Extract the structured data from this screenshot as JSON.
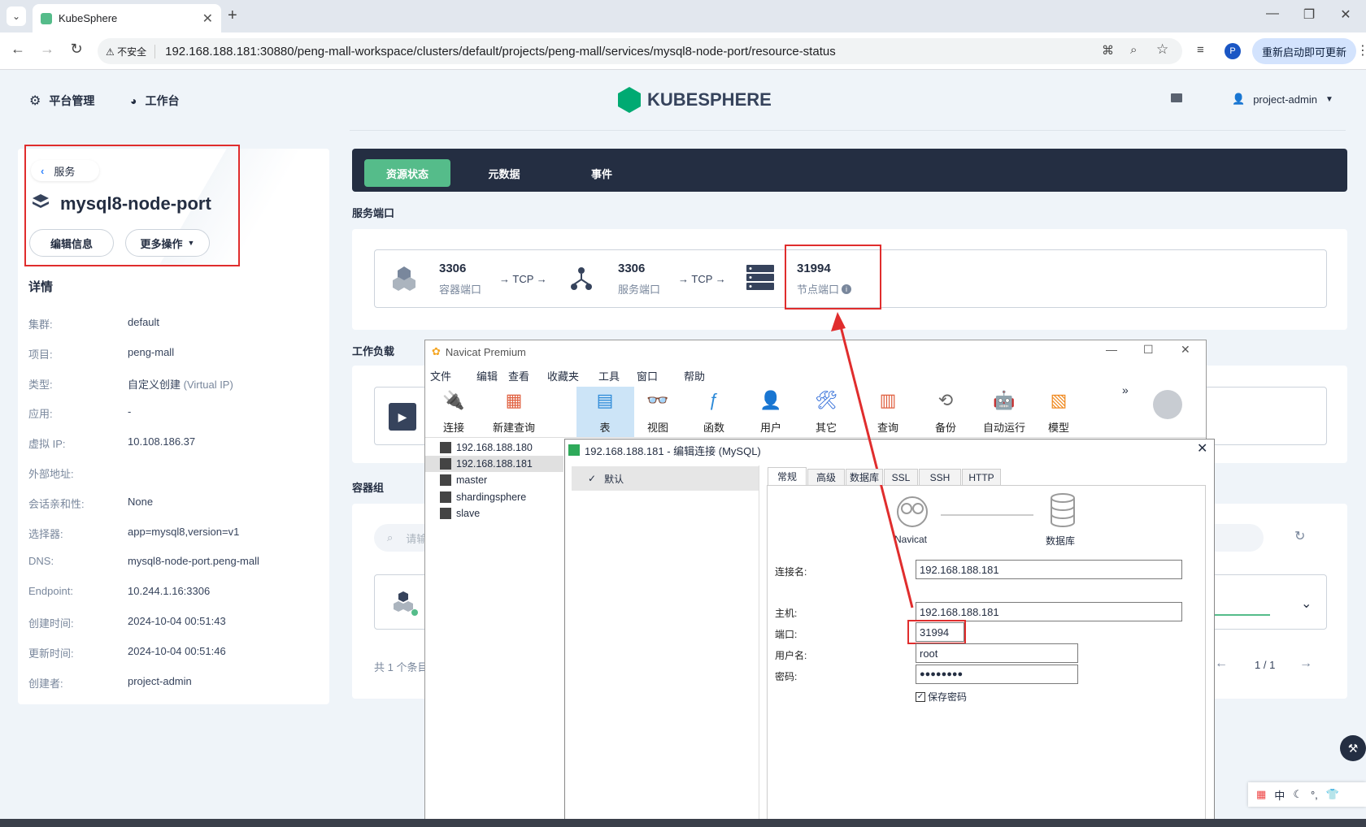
{
  "browser": {
    "tab_title": "KubeSphere",
    "security": "不安全",
    "url": "192.168.188.181:30880/peng-mall-workspace/clusters/default/projects/peng-mall/services/mysql8-node-port/resource-status",
    "update_label": "重新启动即可更新",
    "profile_initial": "P"
  },
  "header": {
    "platform": "平台管理",
    "workbench": "工作台",
    "logo": "KUBESPHERE",
    "user": "project-admin"
  },
  "service": {
    "back_label": "服务",
    "name": "mysql8-node-port",
    "edit_label": "编辑信息",
    "more_label": "更多操作",
    "details_title": "详情",
    "details": [
      {
        "label": "集群:",
        "value": "default"
      },
      {
        "label": "项目:",
        "value": "peng-mall"
      },
      {
        "label": "类型:",
        "value": "自定义创建",
        "extra": "(Virtual IP)"
      },
      {
        "label": "应用:",
        "value": "-"
      },
      {
        "label": "虚拟 IP:",
        "value": "10.108.186.37"
      },
      {
        "label": "外部地址:",
        "value": ""
      },
      {
        "label": "会话亲和性:",
        "value": "None"
      },
      {
        "label": "选择器:",
        "value": "app=mysql8,version=v1"
      },
      {
        "label": "DNS:",
        "value": "mysql8-node-port.peng-mall"
      },
      {
        "label": "Endpoint:",
        "value": "10.244.1.16:3306"
      },
      {
        "label": "创建时间:",
        "value": "2024-10-04 00:51:43"
      },
      {
        "label": "更新时间:",
        "value": "2024-10-04 00:51:46"
      },
      {
        "label": "创建者:",
        "value": "project-admin"
      }
    ]
  },
  "tabs": [
    "资源状态",
    "元数据",
    "事件"
  ],
  "ports": {
    "title": "服务端口",
    "container_port": "3306",
    "container_label": "容器端口",
    "arrow1": "→ TCP →",
    "service_port": "3306",
    "service_label": "服务端口",
    "arrow2": "→ TCP →",
    "node_port": "31994",
    "node_label": "节点端口"
  },
  "workload": {
    "title": "工作负载"
  },
  "pods": {
    "title": "容器组",
    "search_placeholder": "请输",
    "total": "共 1 个条目",
    "pagination": "1 / 1"
  },
  "navicat": {
    "title": "Navicat Premium",
    "menu": [
      "文件",
      "编辑",
      "查看",
      "收藏夹",
      "工具",
      "窗口",
      "帮助"
    ],
    "toolbar": [
      "连接",
      "新建查询",
      "表",
      "视图",
      "函数",
      "用户",
      "其它",
      "查询",
      "备份",
      "自动运行",
      "模型"
    ],
    "more": "»",
    "connections": [
      "192.168.188.180",
      "192.168.188.181",
      "master",
      "shardingsphere",
      "slave"
    ]
  },
  "dialog": {
    "title": "192.168.188.181 - 编辑连接 (MySQL)",
    "profile": "默认",
    "tabs": [
      "常规",
      "高级",
      "数据库",
      "SSL",
      "SSH",
      "HTTP"
    ],
    "navicat_label": "Navicat",
    "db_label": "数据库",
    "conn_name_label": "连接名:",
    "conn_name": "192.168.188.181",
    "host_label": "主机:",
    "host": "192.168.188.181",
    "port_label": "端口:",
    "port": "31994",
    "user_label": "用户名:",
    "user": "root",
    "pwd_label": "密码:",
    "pwd": "●●●●●●●●",
    "save_pwd": "保存密码"
  },
  "ime": {
    "lang": "中"
  },
  "colors": {
    "accent": "#55bc8a",
    "dark": "#242e42",
    "red": "#e02d2d"
  }
}
